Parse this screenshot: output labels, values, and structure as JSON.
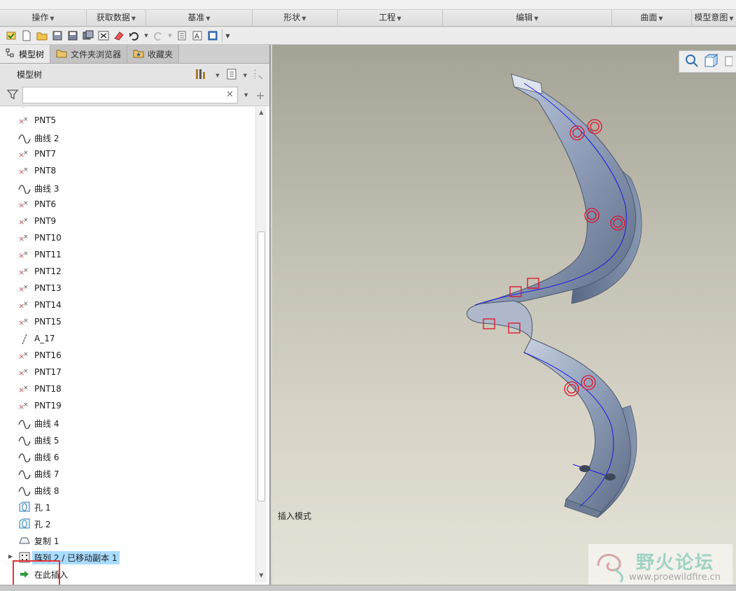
{
  "ribbon": {
    "groups": [
      {
        "label": "操作"
      },
      {
        "label": "获取数据"
      },
      {
        "label": "基准"
      },
      {
        "label": "形状"
      },
      {
        "label": "工程"
      },
      {
        "label": "编辑"
      },
      {
        "label": "曲面"
      },
      {
        "label": "模型意图"
      }
    ]
  },
  "panel": {
    "tabs": [
      {
        "label": "模型树"
      },
      {
        "label": "文件夹浏览器"
      },
      {
        "label": "收藏夹"
      }
    ],
    "header_title": "模型树",
    "filter": {
      "value": "",
      "placeholder": ""
    }
  },
  "tree": {
    "items": [
      {
        "icon": "datum-point-icon",
        "label": "PNT5"
      },
      {
        "icon": "curve-icon",
        "label": "曲线 2"
      },
      {
        "icon": "datum-point-icon",
        "label": "PNT7"
      },
      {
        "icon": "datum-point-icon",
        "label": "PNT8"
      },
      {
        "icon": "curve-icon",
        "label": "曲线 3"
      },
      {
        "icon": "datum-point-icon",
        "label": "PNT6"
      },
      {
        "icon": "datum-point-icon",
        "label": "PNT9"
      },
      {
        "icon": "datum-point-icon",
        "label": "PNT10"
      },
      {
        "icon": "datum-point-icon",
        "label": "PNT11"
      },
      {
        "icon": "datum-point-icon",
        "label": "PNT12"
      },
      {
        "icon": "datum-point-icon",
        "label": "PNT13"
      },
      {
        "icon": "datum-point-icon",
        "label": "PNT14"
      },
      {
        "icon": "datum-point-icon",
        "label": "PNT15"
      },
      {
        "icon": "datum-axis-icon",
        "label": "A_17"
      },
      {
        "icon": "datum-point-icon",
        "label": "PNT16"
      },
      {
        "icon": "datum-point-icon",
        "label": "PNT17"
      },
      {
        "icon": "datum-point-icon",
        "label": "PNT18"
      },
      {
        "icon": "datum-point-icon",
        "label": "PNT19"
      },
      {
        "icon": "curve-icon",
        "label": "曲线 4"
      },
      {
        "icon": "curve-icon",
        "label": "曲线 5"
      },
      {
        "icon": "curve-icon",
        "label": "曲线 6"
      },
      {
        "icon": "curve-icon",
        "label": "曲线 7"
      },
      {
        "icon": "curve-icon",
        "label": "曲线 8"
      },
      {
        "icon": "hole-icon",
        "label": "孔 1"
      },
      {
        "icon": "hole-icon",
        "label": "孔 2"
      },
      {
        "icon": "copy-icon",
        "label": "复制 1"
      },
      {
        "icon": "pattern-icon",
        "label": "阵列 2 / 已移动副本 1",
        "selected": true,
        "expandable": true
      },
      {
        "icon": "insert-here-icon",
        "label": "在此插入"
      }
    ]
  },
  "viewport": {
    "status_text": "插入模式"
  },
  "watermark": {
    "title": "野火论坛",
    "url": "www.proewildfire.cn"
  },
  "colors": {
    "selection": "#a9dcff",
    "highlight_box": "#e53333",
    "model_blue": "#8ea0bb",
    "hole_red": "#e0102a"
  }
}
